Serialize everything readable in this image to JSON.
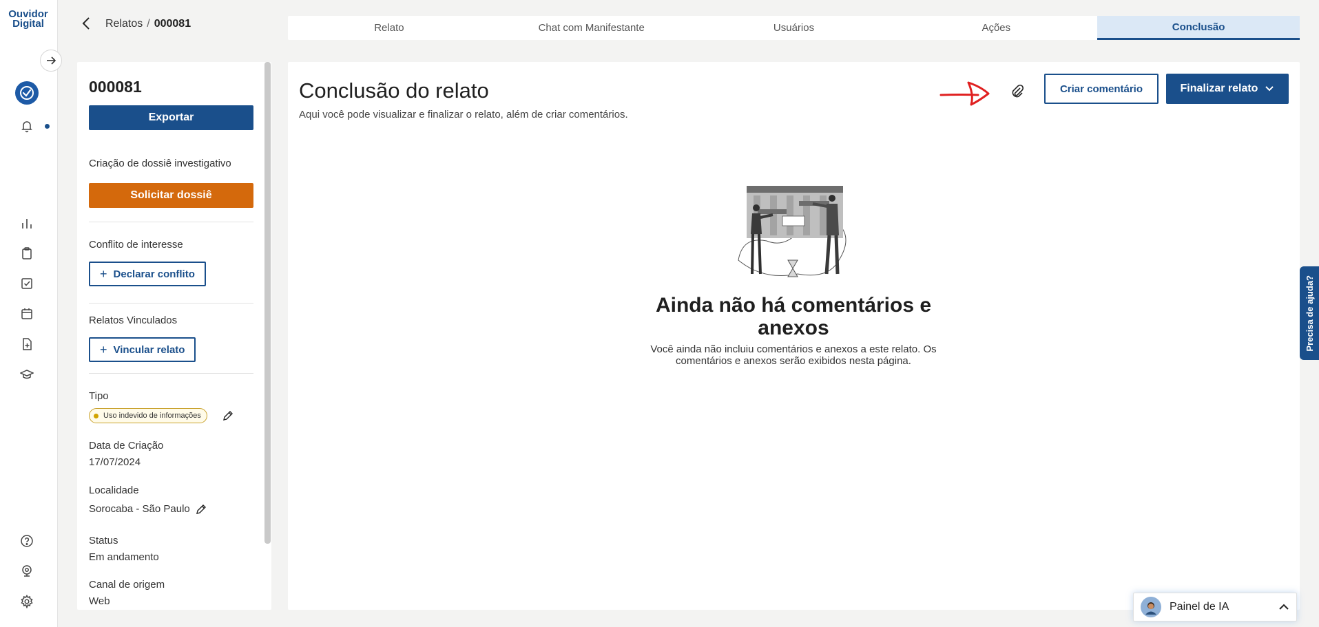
{
  "app": {
    "logo_line1": "Ouvidor",
    "logo_line2": "Digital"
  },
  "breadcrumb": {
    "parent": "Relatos",
    "separator": "/",
    "current": "000081"
  },
  "tabs": [
    {
      "label": "Relato",
      "active": false
    },
    {
      "label": "Chat com Manifestante",
      "active": false
    },
    {
      "label": "Usuários",
      "active": false
    },
    {
      "label": "Ações",
      "active": false
    },
    {
      "label": "Conclusão",
      "active": true
    }
  ],
  "info": {
    "id": "000081",
    "export_label": "Exportar",
    "dossie_section": "Criação de dossiê investigativo",
    "dossie_button": "Solicitar dossiê",
    "conflict_section": "Conflito de interesse",
    "conflict_button": "Declarar conflito",
    "linked_section": "Relatos Vinculados",
    "linked_button": "Vincular relato",
    "tipo_label": "Tipo",
    "tipo_value": "Uso indevido de informações",
    "data_label": "Data de Criação",
    "data_value": "17/07/2024",
    "localidade_label": "Localidade",
    "localidade_value": "Sorocaba - São Paulo",
    "status_label": "Status",
    "status_value": "Em andamento",
    "canal_label": "Canal de origem",
    "canal_value": "Web"
  },
  "main": {
    "title": "Conclusão do relato",
    "subtitle": "Aqui você pode visualizar e finalizar o relato, além de criar comentários.",
    "criar_label": "Criar comentário",
    "finalizar_label": "Finalizar relato",
    "empty_title": "Ainda não há comentários e anexos",
    "empty_desc": "Você ainda não incluiu comentários e anexos a este relato. Os comentários e anexos serão exibidos nesta página."
  },
  "help": {
    "label": "Precisa de ajuda?"
  },
  "ai_panel": {
    "label": "Painel de IA"
  },
  "colors": {
    "primary": "#1a4f8b",
    "orange": "#d4690c",
    "annotation_red": "#e02020",
    "badge_yellow": "#d1a300"
  },
  "icons": {
    "rail": [
      "bar-chart-icon",
      "clipboard-icon",
      "checkbox-icon",
      "calendar-icon",
      "file-plus-icon",
      "graduation-cap-icon",
      "help-circle-icon",
      "webcam-icon",
      "gear-icon"
    ]
  }
}
